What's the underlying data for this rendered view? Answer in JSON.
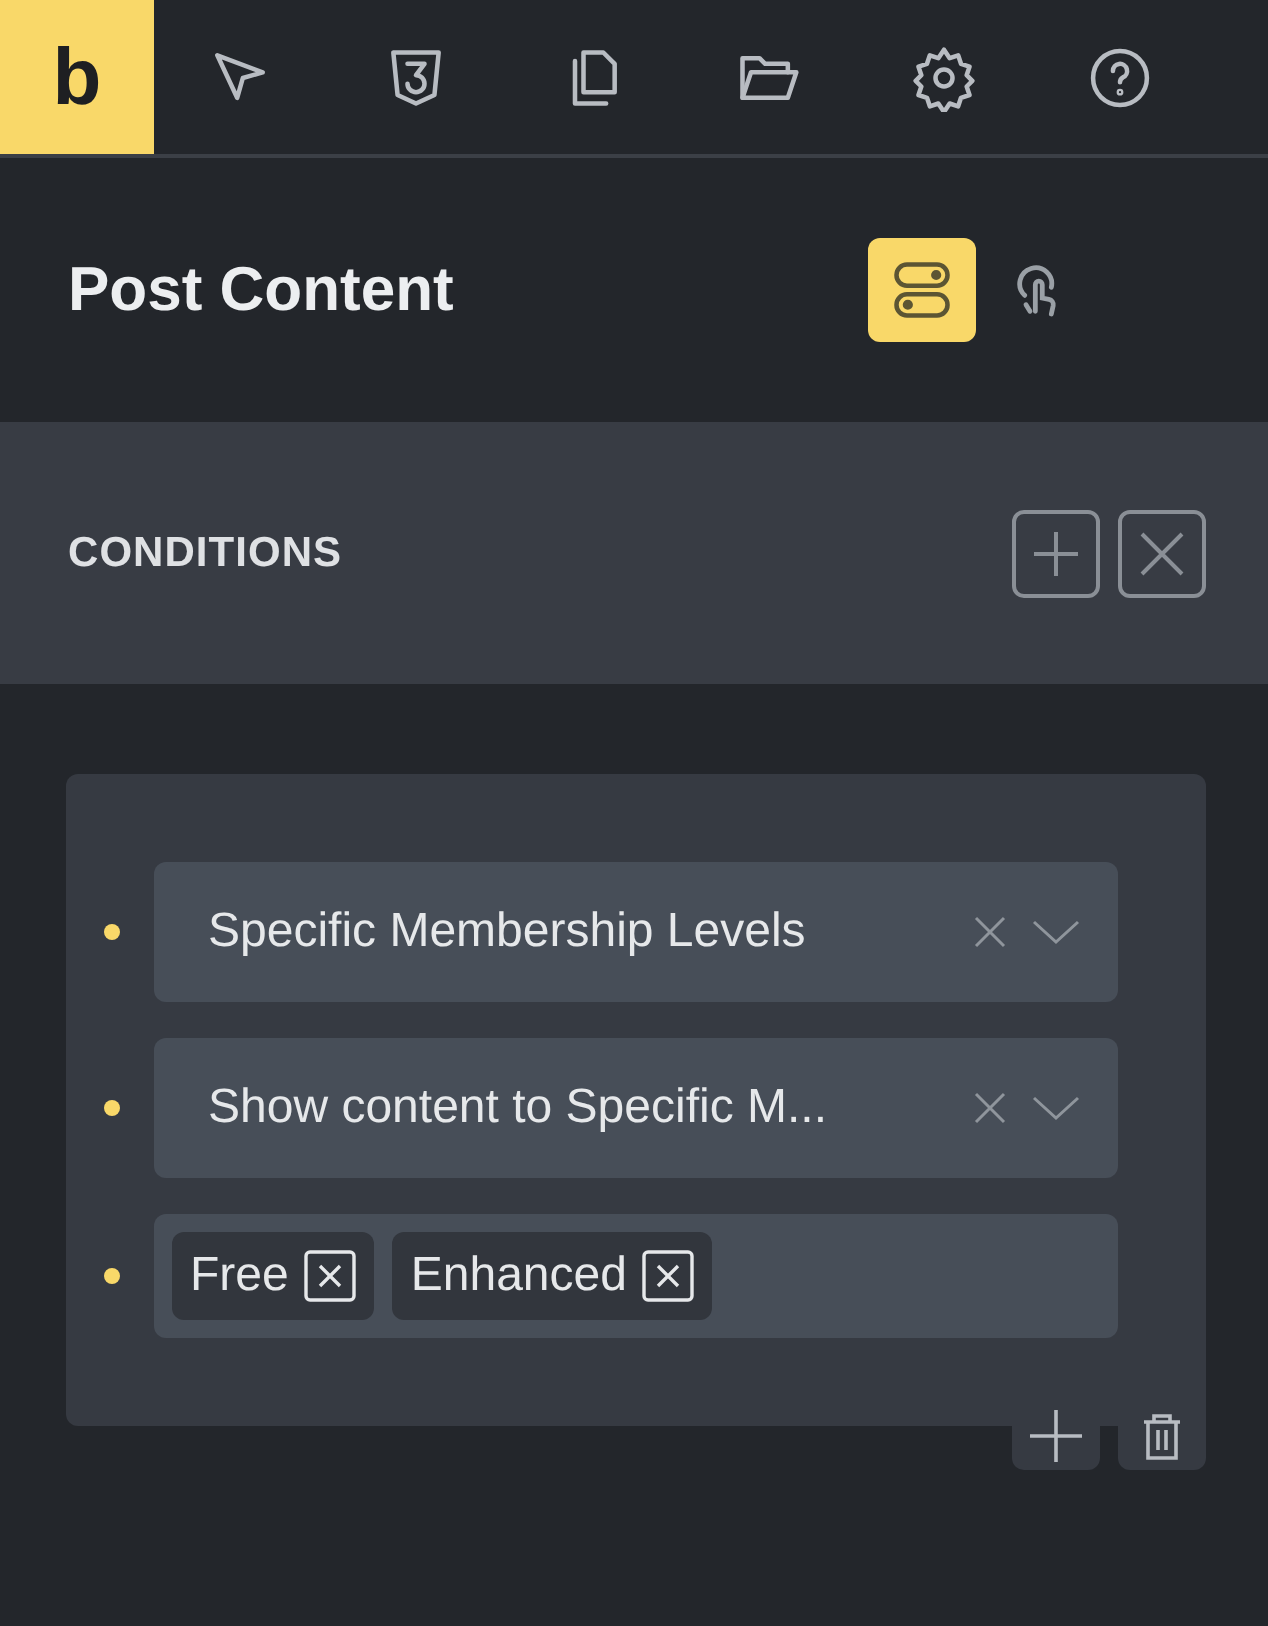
{
  "toolbar": {
    "logo": "b",
    "tools": [
      {
        "kind": "pointer"
      },
      {
        "kind": "css"
      },
      {
        "kind": "pages"
      },
      {
        "kind": "folder"
      },
      {
        "kind": "settings"
      },
      {
        "kind": "help"
      }
    ]
  },
  "panel": {
    "title": "Post Content",
    "modes": [
      {
        "kind": "conditions",
        "selected": true
      },
      {
        "kind": "interactions",
        "selected": false
      }
    ]
  },
  "conditions": {
    "heading": "CONDITIONS",
    "rules": [
      {
        "kind": "select",
        "value": "Specific Membership Levels"
      },
      {
        "kind": "select",
        "value": "Show content to Specific M..."
      },
      {
        "kind": "tags",
        "tags": [
          "Free",
          "Enhanced"
        ]
      }
    ]
  }
}
